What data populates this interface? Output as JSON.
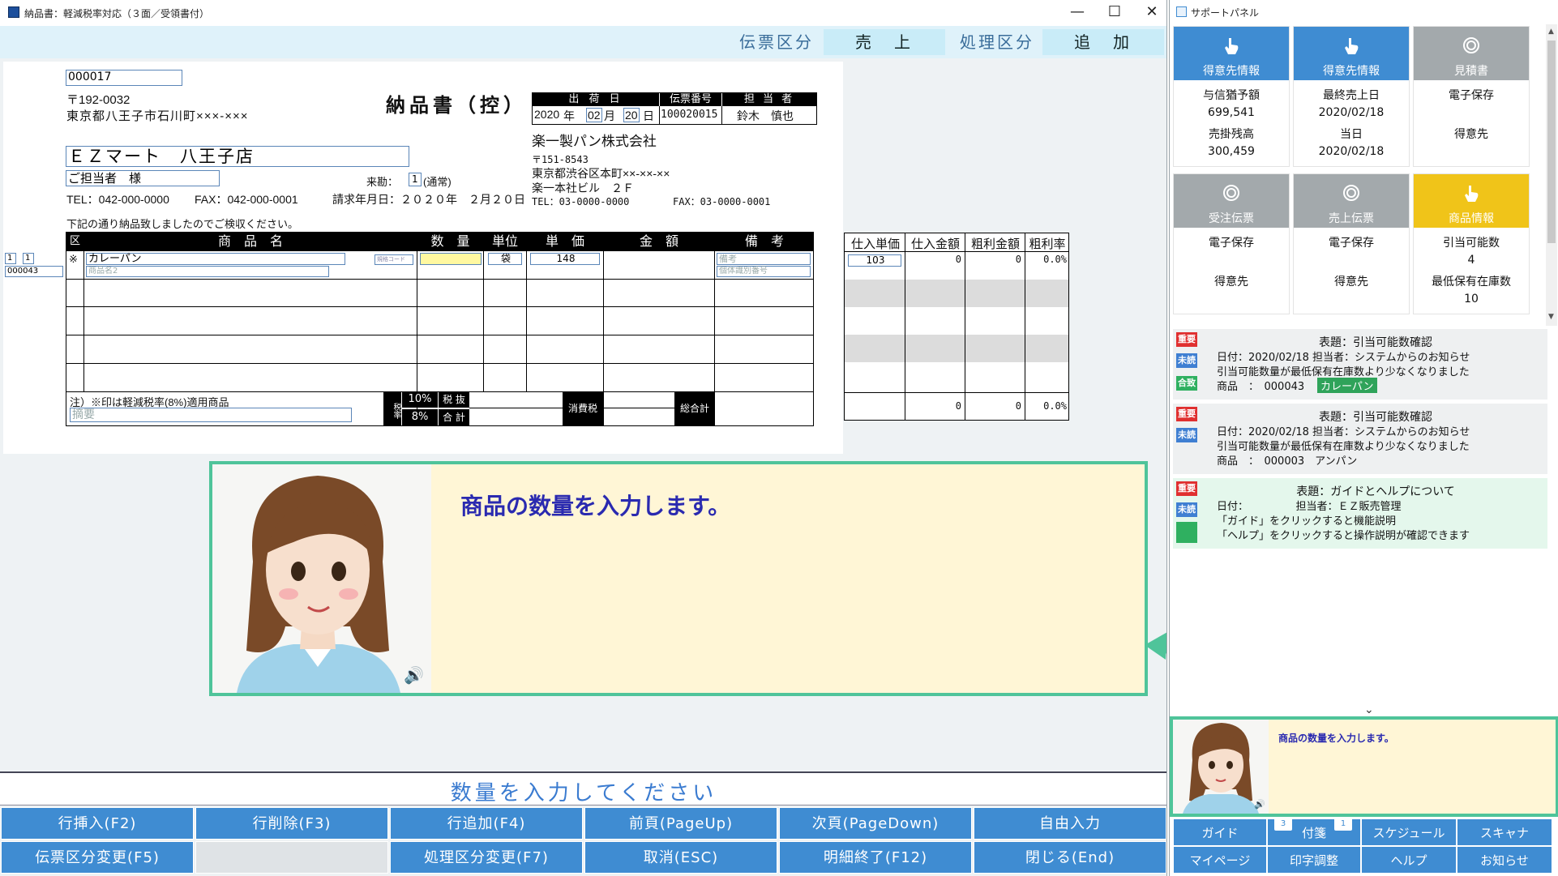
{
  "window": {
    "title": "納品書：軽減税率対応（３面／受領書付）",
    "minimize": "—",
    "maximize": "☐",
    "close": "✕"
  },
  "header": {
    "slip_type_label": "伝票区分",
    "slip_type_value": "売　上",
    "process_type_label": "処理区分",
    "process_type_value": "追　加"
  },
  "doc": {
    "customer_code": "000017",
    "zip": "〒192-0032",
    "address": "東京都八王子市石川町×××-×××",
    "customer_name": "ＥＺマート　八王子店",
    "contact": "ご担当者　様",
    "tel": "TEL：042-000-0000",
    "fax": "FAX：042-000-0001",
    "title": "納品書（控）",
    "visit_label": "来勘：",
    "visit_value": "1",
    "visit_note": "(通常)",
    "billing_date": "請求年月日：２０２０年　２月２０日",
    "note": "下記の通り納品致しましたのでご検収ください。",
    "ship_date_label": "出 荷 日",
    "slip_no_label": "伝票番号",
    "staff_label": "担 当 者",
    "ship_year": "2020",
    "ship_month": "02",
    "ship_day": "20",
    "year_unit": "年",
    "month_unit": "月",
    "day_unit": "日",
    "slip_no": "100020015",
    "staff": "鈴木　慎也",
    "company_name": "楽一製パン株式会社",
    "company_zip": "〒151-8543",
    "company_address": "東京都渋谷区本町××-××-××",
    "company_building": "楽一本社ビル　２Ｆ",
    "company_tel": "TEL：03-0000-0000",
    "company_fax": "FAX：03-0000-0001",
    "left_code_a": "1",
    "left_code_b": "1",
    "left_code_c": "000043"
  },
  "table": {
    "col_kubun": "区",
    "col_product": "商　品　名",
    "col_qty": "数　量",
    "col_unit": "単位",
    "col_price": "単　価",
    "col_amount": "金　額",
    "col_remarks": "備　考",
    "row1_mark": "※",
    "row1_product": "カレーパン",
    "row1_product2": "商品名2",
    "row1_code_btn": "規格コード",
    "row1_unit": "袋",
    "row1_price": "148",
    "row1_remark1": "備考",
    "row1_remark2": "個体識別番号",
    "footer_note": "注）※印は軽減税率(8%)適用商品",
    "memo_placeholder": "摘要",
    "tax_rate_label": "税率",
    "rate10": "10%",
    "rate8": "8%",
    "tax_excl": "税 抜",
    "total_sub": "合 計",
    "tax_label": "消費税",
    "grand_total": "総合計"
  },
  "cost": {
    "col_cost_price": "仕入単価",
    "col_cost_amount": "仕入金額",
    "col_profit": "粗利金額",
    "col_profit_rate": "粗利率",
    "row1_cost_price": "103",
    "row1_cost_amount": "0",
    "row1_profit": "0",
    "row1_rate": "0.0%",
    "total_cost": "0",
    "total_profit": "0",
    "total_rate": "0.0%"
  },
  "guide": {
    "message": "商品の数量を入力します。",
    "speaker": "🔊"
  },
  "instruction": "数量を入力してください",
  "fn_buttons": {
    "insert": "行挿入(F2)",
    "delete": "行削除(F3)",
    "add": "行追加(F4)",
    "prev": "前頁(PageUp)",
    "next": "次頁(PageDown)",
    "free": "自由入力",
    "slip_change": "伝票区分変更(F5)",
    "proc_change": "処理区分変更(F7)",
    "cancel": "取消(ESC)",
    "detail_end": "明細終了(F12)",
    "close": "閉じる(End)"
  },
  "support": {
    "title": "サポートパネル",
    "tiles": [
      {
        "label": "得意先情報",
        "l1": "与信猶予額",
        "l2": "699,541",
        "l3": "売掛残高",
        "l4": "300,459"
      },
      {
        "label": "得意先情報",
        "l1": "最終売上日",
        "l2": "2020/02/18",
        "l3": "当日",
        "l4": "2020/02/18"
      },
      {
        "label": "見積書",
        "l1": "電子保存",
        "l2": "",
        "l3": "得意先",
        "l4": ""
      },
      {
        "label": "受注伝票",
        "l1": "電子保存",
        "l2": "",
        "l3": "得意先",
        "l4": ""
      },
      {
        "label": "売上伝票",
        "l1": "電子保存",
        "l2": "",
        "l3": "得意先",
        "l4": ""
      },
      {
        "label": "商品情報",
        "l1": "引当可能数",
        "l2": "4",
        "l3": "最低保有在庫数",
        "l4": "10"
      }
    ],
    "notices": [
      {
        "tag1": "重要",
        "tag2": "未読",
        "tag3": "合致",
        "title": "表題：引当可能数確認",
        "l1": "日付：2020/02/18 担当者：システムからのお知らせ",
        "l2": "引当可能数量が最低保有在庫数より少なくなりました",
        "l3a": "商品　：　000043",
        "l3b": "カレーパン"
      },
      {
        "tag1": "重要",
        "tag2": "未読",
        "title": "表題：引当可能数確認",
        "l1": "日付：2020/02/18 担当者：システムからのお知らせ",
        "l2": "引当可能数量が最低保有在庫数より少なくなりました",
        "l3a": "商品　：　000003　アンパン"
      },
      {
        "tag1": "重要",
        "tag2": "未読",
        "title": "表題：ガイドとヘルプについて",
        "l1": "日付：　　　　　担当者：ＥＺ販売管理",
        "l2": "「ガイド」をクリックすると機能説明",
        "l3a": "「ヘルプ」をクリックすると操作説明が確認できます"
      }
    ],
    "mini_message": "商品の数量を入力します。",
    "buttons": {
      "guide": "ガイド",
      "sticky": "付箋",
      "sticky_count": "3",
      "sticky_count2": "1",
      "schedule": "スケジュール",
      "scanner": "スキャナ",
      "mypage": "マイページ",
      "print_adjust": "印字調整",
      "help": "ヘルプ",
      "notice": "お知らせ"
    }
  },
  "colors": {
    "accent": "#3f8cd2",
    "guide_border": "#4fc49a",
    "guide_bg": "#fff6d6",
    "tile_yellow": "#f0c419"
  }
}
